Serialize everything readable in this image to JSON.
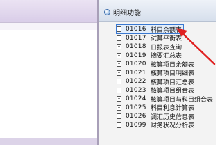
{
  "panel": {
    "title": "明细功能"
  },
  "items": [
    {
      "code": "01016",
      "name": "科目余额表"
    },
    {
      "code": "01017",
      "name": "试算平衡表"
    },
    {
      "code": "01018",
      "name": "日报表查询"
    },
    {
      "code": "01019",
      "name": "摘要汇总表"
    },
    {
      "code": "01020",
      "name": "核算项目余额表"
    },
    {
      "code": "01021",
      "name": "核算项目明细表"
    },
    {
      "code": "01022",
      "name": "核算项目汇总表"
    },
    {
      "code": "01023",
      "name": "核算项目组合表"
    },
    {
      "code": "01024",
      "name": "核算项目与科目组合表"
    },
    {
      "code": "01025",
      "name": "科目利息计算表"
    },
    {
      "code": "01026",
      "name": "调汇历史信息表"
    },
    {
      "code": "01099",
      "name": "财务状况分析表"
    }
  ],
  "selected_index": 0,
  "colors": {
    "selection_border": "#3a78d0",
    "annotation_arrow": "#e02020"
  },
  "icons": {
    "panel": "circle-bullet-icon",
    "item": "document-icon"
  }
}
